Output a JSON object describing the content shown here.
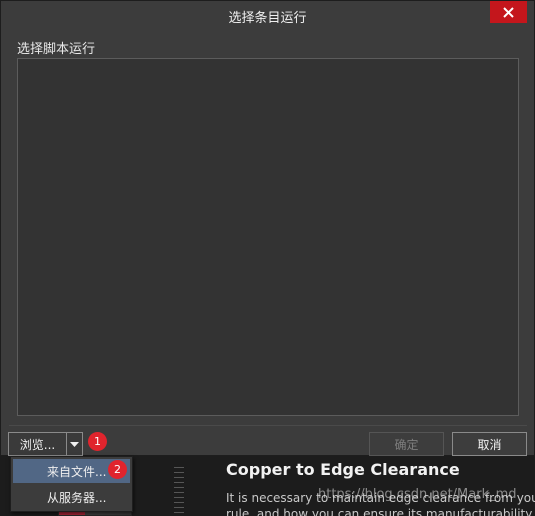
{
  "dialog": {
    "title": "选择条目运行",
    "section_label": "选择脚本运行",
    "browse_label": "浏览...",
    "ok_label": "确定",
    "cancel_label": "取消",
    "ok_enabled": false
  },
  "dropdown": {
    "items": [
      {
        "label": "来自文件...",
        "active": true
      },
      {
        "label": "从服务器...",
        "active": false
      }
    ]
  },
  "badges": {
    "browse": "1",
    "from_file": "2"
  },
  "background": {
    "title": "Copper to Edge Clearance",
    "text_line1": "It is necessary to maintain edge clearance from your",
    "text_line2": "rule, and how you can ensure its manufacturability",
    "watermark": "https://blog.csdn.net/Mark_md"
  },
  "colors": {
    "close_button": "#c4161c",
    "badge": "#e0242d",
    "menu_highlight": "#516785",
    "dialog_bg": "#3c3c3c",
    "list_bg": "#333333"
  },
  "icons": {
    "close": "close-icon",
    "dropdown": "caret-down-icon"
  }
}
